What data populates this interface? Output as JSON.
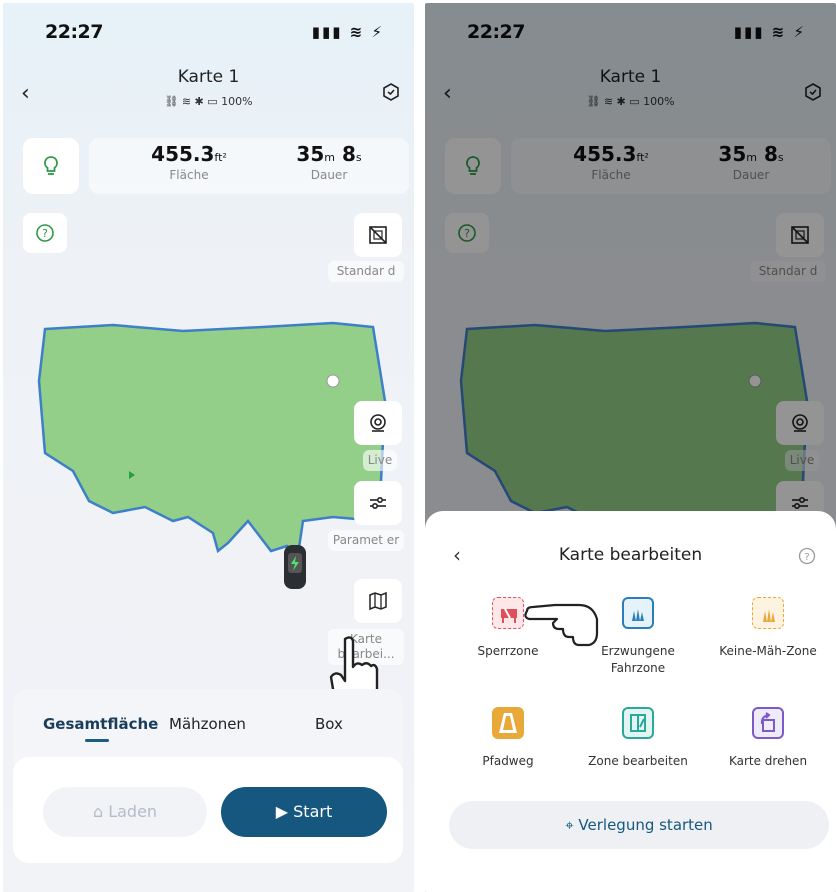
{
  "left": {
    "time": "22:27",
    "title": "Karte 1",
    "battery": "100%",
    "stats": {
      "area_value": "455.3",
      "area_unit": "ft²",
      "area_label": "Fläche",
      "dur_min": "35",
      "dur_sec": "8",
      "dur_min_unit": "m",
      "dur_sec_unit": "s",
      "dur_label": "Dauer"
    },
    "side": {
      "standard": "Standar d",
      "live": "Live",
      "param": "Paramet er",
      "karte": "Karte bearbei..."
    },
    "tabs": [
      "Gesamtfläche",
      "Mähzonen",
      "Box"
    ],
    "buttons": {
      "laden": "Laden",
      "start": "Start"
    }
  },
  "right": {
    "time": "22:27",
    "title": "Karte 1",
    "battery": "100%",
    "stats": {
      "area_value": "455.3",
      "area_unit": "ft²",
      "area_label": "Fläche",
      "dur_min": "35",
      "dur_sec": "8",
      "dur_min_unit": "m",
      "dur_sec_unit": "s",
      "dur_label": "Dauer"
    },
    "side": {
      "standard": "Standar d",
      "live": "Live"
    },
    "sheet": {
      "title": "Karte bearbeiten",
      "tools": [
        {
          "label": "Sperrzone",
          "icon": "barrier-icon",
          "color": "#e0505a"
        },
        {
          "label": "Erzwungene Fahrzone",
          "icon": "grass-frame-icon",
          "color": "#2a7fb8"
        },
        {
          "label": "Keine-Mäh-Zone",
          "icon": "no-mow-icon",
          "color": "#e8a93a"
        },
        {
          "label": "Pfadweg",
          "icon": "path-icon",
          "color": "#e8a93a"
        },
        {
          "label": "Zone bearbeiten",
          "icon": "zone-edit-icon",
          "color": "#2aa89a"
        },
        {
          "label": "Karte drehen",
          "icon": "rotate-map-icon",
          "color": "#7a5bc7"
        }
      ],
      "button": "Verlegung starten"
    }
  },
  "colors": {
    "accent": "#16577f",
    "map_green": "#93cf88",
    "map_outline": "#3d7fc8"
  }
}
